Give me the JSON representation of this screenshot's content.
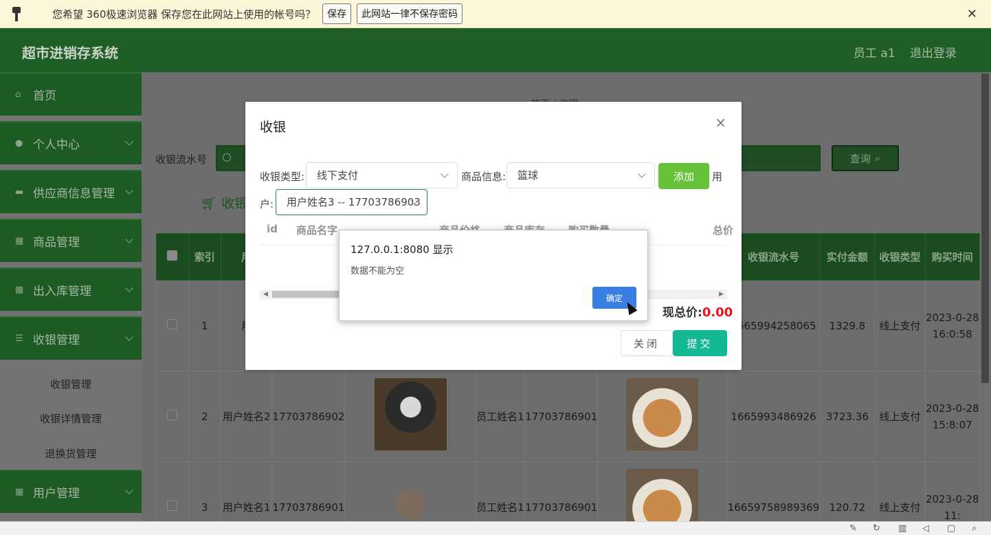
{
  "browser_bar": {
    "message": "您希望 360极速浏览器 保存您在此网站上使用的帐号吗？",
    "save_label": "保存",
    "never_label": "此网站一律不保存密码",
    "close_glyph": "✕"
  },
  "header": {
    "title": "超市进销存系统",
    "user": "员工 a1",
    "logout": "退出登录"
  },
  "sidebar": {
    "items": [
      {
        "label": "首页",
        "icon": "home-icon",
        "glyph": "⌂"
      },
      {
        "label": "个人中心",
        "icon": "user-icon",
        "glyph": "●"
      },
      {
        "label": "供应商信息管理",
        "icon": "monitor-icon",
        "glyph": "▬"
      },
      {
        "label": "商品管理",
        "icon": "grid-icon",
        "glyph": "▦"
      },
      {
        "label": "出入库管理",
        "icon": "grid-icon",
        "glyph": "▦"
      },
      {
        "label": "收银管理",
        "icon": "list-icon",
        "glyph": "☰"
      },
      {
        "label": "用户管理",
        "icon": "grid-icon",
        "glyph": "▦"
      }
    ],
    "sub_items": [
      "收银管理",
      "收银详情管理",
      "退换货管理"
    ]
  },
  "main": {
    "breadcrumb": "首页 / 收银",
    "search_label": "收银流水号",
    "search_placeholder": "收",
    "query_button": "查询",
    "list_title": "收银",
    "table_headers": [
      "索引",
      "用",
      "",
      "",
      "",
      "",
      "",
      "",
      "收银流水号",
      "实付金额",
      "收银类型",
      "购买时间"
    ],
    "rows": [
      {
        "index": "1",
        "user": "用",
        "phone": "",
        "staff": "",
        "staff_phone": "",
        "serial": "1665994258065",
        "amount": "1329.8",
        "type": "线上支付",
        "time": "2023-0-28 16:0:58"
      },
      {
        "index": "2",
        "user": "用户姓名2",
        "phone": "17703786902",
        "staff": "员工姓名1",
        "staff_phone": "17703786901",
        "serial": "1665993486926",
        "amount": "3723.36",
        "type": "线上支付",
        "time": "2023-0-28 15:8:07"
      },
      {
        "index": "3",
        "user": "用户姓名1",
        "phone": "17703786901",
        "staff": "员工姓名1",
        "staff_phone": "17703786901",
        "serial": "16659758989369",
        "amount": "120.72",
        "type": "线上支付",
        "time": "2023-0-28 11:"
      }
    ]
  },
  "dialog": {
    "title": "收银",
    "close_glyph": "×",
    "pay_type_label": "收银类型:",
    "pay_type_value": "线下支付",
    "goods_label": "商品信息:",
    "goods_value": "篮球",
    "add_button": "添加",
    "user_label_a": "用",
    "user_label_b": "户:",
    "user_value": "用户姓名3 -- 17703786903",
    "columns": [
      "id",
      "商品名字",
      "商品价格",
      "商品库存",
      "购买数量",
      "总价"
    ],
    "total_label": "现总价:",
    "total_value": "0.00",
    "close_button": "关闭",
    "submit_button": "提交"
  },
  "alert": {
    "title": "127.0.0.1:8080 显示",
    "message": "数据不能为空",
    "ok_button": "确定"
  },
  "colors": {
    "header_green": "#1f5e26",
    "add_green": "#67c23a",
    "submit_teal": "#14b893",
    "total_red": "#e4161b",
    "alert_blue": "#3a7ee4"
  }
}
